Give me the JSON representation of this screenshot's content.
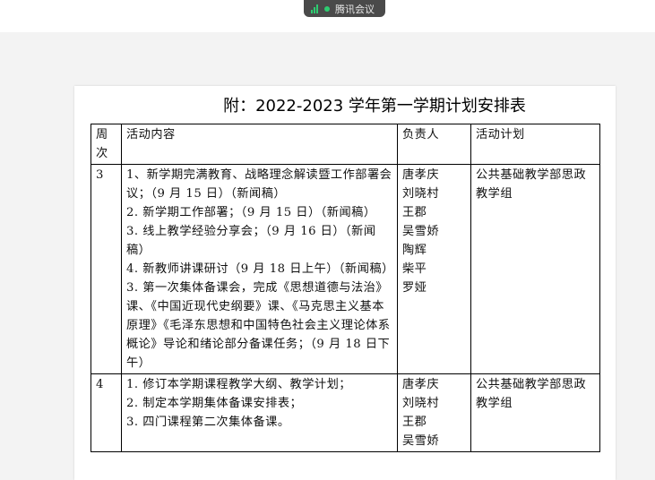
{
  "meeting_app": {
    "label": "腾讯会议"
  },
  "document": {
    "title": "附：2022-2023 学年第一学期计划安排表",
    "headers": {
      "week": "周次",
      "content": "活动内容",
      "owner": "负责人",
      "plan": "活动计划"
    },
    "rows": [
      {
        "week": "3",
        "content": [
          "1、新学期完满教育、战略理念解读暨工作部署会议；（9 月 15 日）（新闻稿）",
          "2. 新学期工作部署；（9 月 15 日）（新闻稿）",
          "3. 线上教学经验分享会；（9 月 16 日）（新闻稿）",
          "4. 新教师讲课研讨（9 月 18 日上午）（新闻稿）",
          "3. 第一次集体备课会，完成《思想道德与法治》课、《中国近现代史纲要》课、《马克思主义基本原理》《毛泽东思想和中国特色社会主义理论体系概论》导论和绪论部分备课任务；（9 月 18 日下午）"
        ],
        "owners": [
          "唐孝庆",
          "刘晓村",
          "王郡",
          "吴雪娇",
          "陶辉",
          "柴平",
          "罗娅"
        ],
        "plan": "公共基础教学部思政教学组"
      },
      {
        "week": "4",
        "content": [
          "1. 修订本学期课程教学大纲、教学计划；",
          "2. 制定本学期集体备课安排表；",
          "3. 四门课程第二次集体备课。"
        ],
        "owners": [
          "唐孝庆",
          "刘晓村",
          "王郡",
          "吴雪娇"
        ],
        "plan": "公共基础教学部思政教学组"
      }
    ]
  }
}
